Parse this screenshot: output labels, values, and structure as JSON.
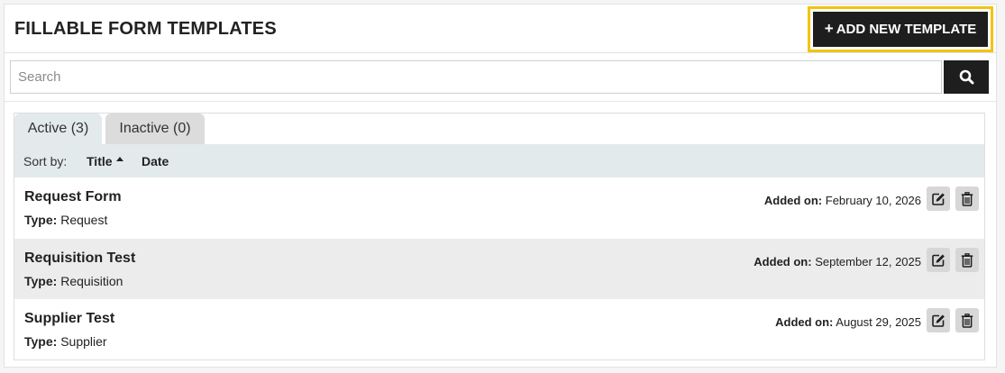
{
  "header": {
    "title": "FILLABLE FORM TEMPLATES",
    "add_button_label": "ADD NEW TEMPLATE",
    "add_button_icon": "plus-icon",
    "highlight_color": "#f2c40e"
  },
  "search": {
    "placeholder": "Search",
    "value": "",
    "button_icon": "search-icon"
  },
  "tabs": [
    {
      "label": "Active (3)",
      "active": true
    },
    {
      "label": "Inactive (0)",
      "active": false
    }
  ],
  "sort": {
    "label": "Sort by:",
    "options": [
      "Title",
      "Date"
    ],
    "active": "Title",
    "direction": "ascending"
  },
  "templates": [
    {
      "title": "Request Form",
      "type_label": "Type:",
      "type": "Request",
      "added_label": "Added on:",
      "added": "February 10, 2026"
    },
    {
      "title": "Requisition Test",
      "type_label": "Type:",
      "type": "Requisition",
      "added_label": "Added on:",
      "added": "September 12, 2025"
    },
    {
      "title": "Supplier Test",
      "type_label": "Type:",
      "type": "Supplier",
      "added_label": "Added on:",
      "added": "August 29, 2025"
    }
  ],
  "row_actions": {
    "edit_icon": "edit-icon",
    "delete_icon": "trash-icon"
  },
  "colors": {
    "dark": "#1e1e1e",
    "sort_bar": "#e3eaec",
    "row_alt": "#ececec"
  }
}
